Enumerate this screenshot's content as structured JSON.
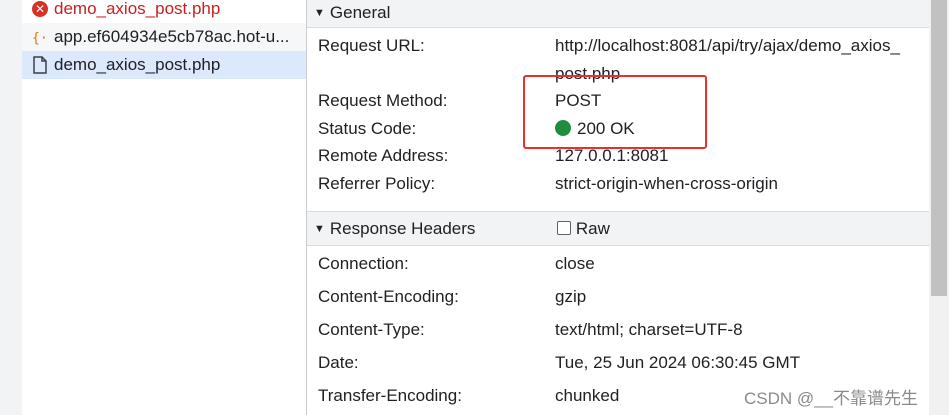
{
  "request_list": [
    {
      "name": "demo_axios_post.php",
      "icon": "error-icon",
      "state": "error"
    },
    {
      "name": "app.ef604934e5cb78ac.hot-u...",
      "icon": "json-icon",
      "state": "normal"
    },
    {
      "name": "demo_axios_post.php",
      "icon": "document-icon",
      "state": "selected"
    }
  ],
  "general": {
    "title": "General",
    "request_url_label": "Request URL:",
    "request_url_line1": "http://localhost:8081/api/try/ajax/demo_axios_",
    "request_url_line2": "post.php",
    "request_method_label": "Request Method:",
    "request_method_value": "POST",
    "status_code_label": "Status Code:",
    "status_code_value": "200 OK",
    "remote_address_label": "Remote Address:",
    "remote_address_value": "127.0.0.1:8081",
    "referrer_policy_label": "Referrer Policy:",
    "referrer_policy_value": "strict-origin-when-cross-origin"
  },
  "response_headers": {
    "title": "Response Headers",
    "raw_label": "Raw",
    "rows": [
      {
        "key": "Connection:",
        "value": "close"
      },
      {
        "key": "Content-Encoding:",
        "value": "gzip"
      },
      {
        "key": "Content-Type:",
        "value": "text/html; charset=UTF-8"
      },
      {
        "key": "Date:",
        "value": "Tue, 25 Jun 2024 06:30:45 GMT"
      },
      {
        "key": "Transfer-Encoding:",
        "value": "chunked"
      }
    ]
  },
  "watermark": "CSDN @__不靠谱先生",
  "colors": {
    "status_ok": "#1e8e3e",
    "error": "#d93025",
    "highlight": "#e8312f",
    "selected_bg": "#dce8fc"
  }
}
